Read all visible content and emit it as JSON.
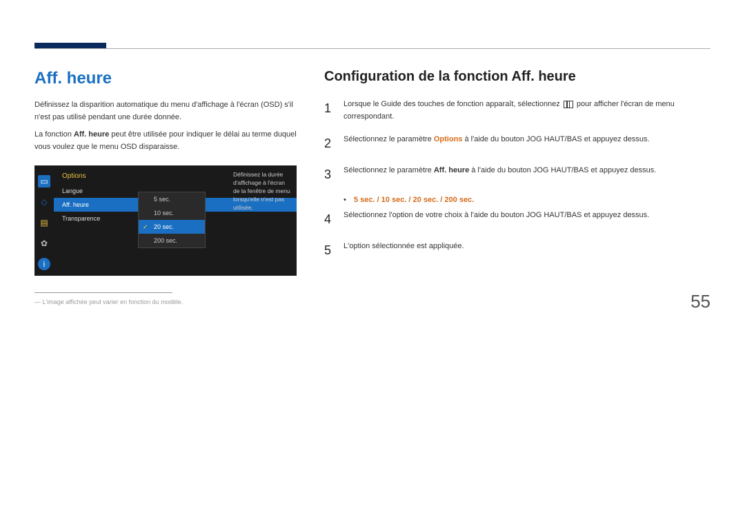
{
  "left": {
    "heading": "Aff. heure",
    "para1_a": "Définissez la disparition automatique du menu d'affichage à l'écran (OSD) s'il n'est pas utilisé pendant une durée donnée.",
    "para2_a": "La fonction ",
    "para2_bold": "Aff. heure",
    "para2_b": " peut être utilisée pour indiquer le délai au terme duquel vous voulez que le menu OSD disparaisse.",
    "osd": {
      "title": "Options",
      "items": [
        "Langue",
        "Aff. heure",
        "Transparence"
      ],
      "sub": [
        "5 sec.",
        "10 sec.",
        "20 sec.",
        "200 sec."
      ],
      "desc": "Définissez la durée d'affichage à l'écran de la fenêtre de menu lorsqu'elle n'est pas utilisée."
    },
    "footnote": "― L'image affichée peut varier en fonction du modèle."
  },
  "right": {
    "heading": "Configuration de la fonction Aff. heure",
    "step1_a": "Lorsque le Guide des touches de fonction apparaît, sélectionnez ",
    "step1_b": " pour afficher l'écran de menu correspondant.",
    "step2_a": "Sélectionnez le paramètre ",
    "step2_bold": "Options",
    "step2_b": " à l'aide du bouton JOG HAUT/BAS et appuyez dessus.",
    "step3_a": "Sélectionnez le paramètre ",
    "step3_bold": "Aff. heure",
    "step3_b": " à l'aide du bouton JOG HAUT/BAS et appuyez dessus.",
    "options_line": "5 sec. / 10 sec. / 20 sec. / 200 sec.",
    "step4": "Sélectionnez l'option de votre choix à l'aide du bouton JOG HAUT/BAS et appuyez dessus.",
    "step5": "L'option sélectionnée est appliquée.",
    "nums": [
      "1",
      "2",
      "3",
      "4",
      "5"
    ]
  },
  "page_number": "55"
}
